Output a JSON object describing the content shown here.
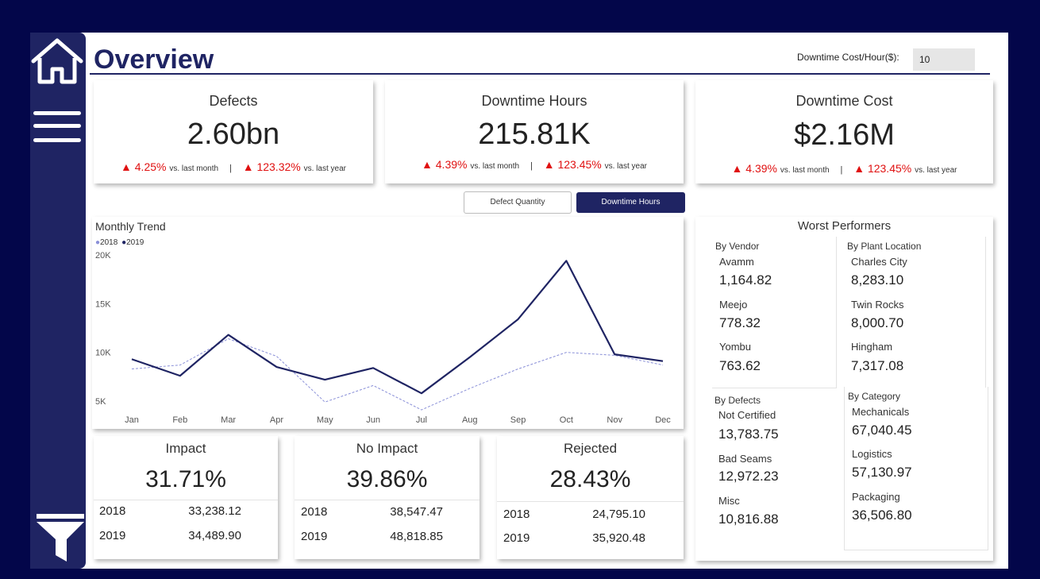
{
  "header": {
    "title": "Overview",
    "cost_label": "Downtime Cost/Hour($):",
    "cost_value": "10"
  },
  "kpis": [
    {
      "title": "Defects",
      "value": "2.60bn",
      "month_delta": "4.25%",
      "month_label": "vs. last month",
      "year_delta": "123.32%",
      "year_label": "vs. last year"
    },
    {
      "title": "Downtime Hours",
      "value": "215.81K",
      "month_delta": "4.39%",
      "month_label": "vs. last month",
      "year_delta": "123.45%",
      "year_label": "vs. last year"
    },
    {
      "title": "Downtime Cost",
      "value": "$2.16M",
      "month_delta": "4.39%",
      "month_label": "vs. last month",
      "year_delta": "123.45%",
      "year_label": "vs. last year"
    }
  ],
  "toggle": {
    "defect_quantity": "Defect Quantity",
    "downtime_hours": "Downtime Hours",
    "active": "Downtime Hours"
  },
  "colors": {
    "navy": "#1f2463",
    "background": "#03064a",
    "accent_2018": "#7f86d9",
    "up": "#e01010"
  },
  "chart_data": {
    "type": "line",
    "title": "Monthly Trend",
    "categories": [
      "Jan",
      "Feb",
      "Mar",
      "Apr",
      "May",
      "Jun",
      "Jul",
      "Aug",
      "Sep",
      "Oct",
      "Nov",
      "Dec"
    ],
    "yticks": [
      "20K",
      "15K",
      "10K",
      "5K"
    ],
    "ylim": [
      5000,
      20000
    ],
    "legend_position": "top-left",
    "series": [
      {
        "name": "2018",
        "color": "#8a90d8",
        "style": "dashed",
        "values": [
          8300,
          8700,
          11400,
          9600,
          4900,
          6600,
          4100,
          6300,
          8300,
          10000,
          9700,
          8700
        ]
      },
      {
        "name": "2019",
        "color": "#1f2463",
        "style": "solid",
        "values": [
          9300,
          7600,
          11800,
          8500,
          7200,
          8400,
          5800,
          9500,
          13400,
          19400,
          9800,
          9100
        ]
      }
    ]
  },
  "breakdown": [
    {
      "title": "Impact",
      "value": "31.71%",
      "rows": [
        {
          "year": "2018",
          "value": "33,238.12"
        },
        {
          "year": "2019",
          "value": "34,489.90"
        }
      ]
    },
    {
      "title": "No Impact",
      "value": "39.86%",
      "rows": [
        {
          "year": "2018",
          "value": "38,547.47"
        },
        {
          "year": "2019",
          "value": "48,818.85"
        }
      ]
    },
    {
      "title": "Rejected",
      "value": "28.43%",
      "rows": [
        {
          "year": "2018",
          "value": "24,795.10"
        },
        {
          "year": "2019",
          "value": "35,920.48"
        }
      ]
    }
  ],
  "worst": {
    "title": "Worst Performers",
    "vendor": {
      "label": "By Vendor",
      "items": [
        {
          "name": "Avamm",
          "value": "1,164.82"
        },
        {
          "name": "Meejo",
          "value": "778.32"
        },
        {
          "name": "Yombu",
          "value": "763.62"
        }
      ]
    },
    "plant": {
      "label": "By Plant Location",
      "items": [
        {
          "name": "Charles City",
          "value": "8,283.10"
        },
        {
          "name": "Twin Rocks",
          "value": "8,000.70"
        },
        {
          "name": "Hingham",
          "value": "7,317.08"
        }
      ]
    },
    "defects": {
      "label": "By Defects",
      "items": [
        {
          "name": "Not Certified",
          "value": "13,783.75"
        },
        {
          "name": "Bad Seams",
          "value": "12,972.23"
        },
        {
          "name": "Misc",
          "value": "10,816.88"
        }
      ]
    },
    "category": {
      "label": "By Category",
      "items": [
        {
          "name": "Mechanicals",
          "value": "67,040.45"
        },
        {
          "name": "Logistics",
          "value": "57,130.97"
        },
        {
          "name": "Packaging",
          "value": "36,506.80"
        }
      ]
    }
  },
  "icons": {
    "home": "home-icon",
    "menu": "hamburger-menu-icon",
    "filter": "funnel-filter-icon"
  }
}
